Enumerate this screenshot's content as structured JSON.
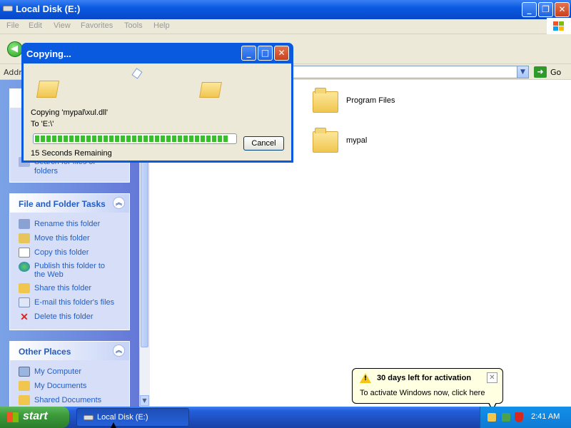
{
  "window": {
    "title": "Local Disk (E:)"
  },
  "menu": [
    "File",
    "Edit",
    "View",
    "Favorites",
    "Tools",
    "Help"
  ],
  "address": {
    "label": "Addre",
    "go_label": "Go"
  },
  "left_pane": {
    "file_folder_tasks": {
      "title": "File and Folder Tasks",
      "items": [
        "Rename this folder",
        "Move this folder",
        "Copy this folder",
        "Publish this folder to the Web",
        "Share this folder",
        "E-mail this folder's files",
        "Delete this folder"
      ]
    },
    "other_places": {
      "title": "Other Places",
      "items": [
        "My Computer",
        "My Documents",
        "Shared Documents"
      ]
    },
    "search_fragment": {
      "line1": "Search for files or",
      "line2": "folders"
    }
  },
  "files": [
    {
      "name": "Program Files"
    },
    {
      "name": "mypal"
    }
  ],
  "dialog": {
    "title": "Copying...",
    "copying_text": "Copying 'mypal\\xul.dll'",
    "to_text": "To 'E:\\'",
    "remaining": "15 Seconds Remaining",
    "cancel_label": "Cancel",
    "progress_percent": 97
  },
  "balloon": {
    "title": "30 days left for activation",
    "text": "To activate Windows now, click here"
  },
  "taskbar": {
    "start_label": "start",
    "task_label": "Local Disk (E:)",
    "clock": "2:41 AM"
  },
  "colors": {
    "xp_blue": "#0a5ae0",
    "task_link": "#215dc6",
    "progress_green": "#37c029"
  }
}
